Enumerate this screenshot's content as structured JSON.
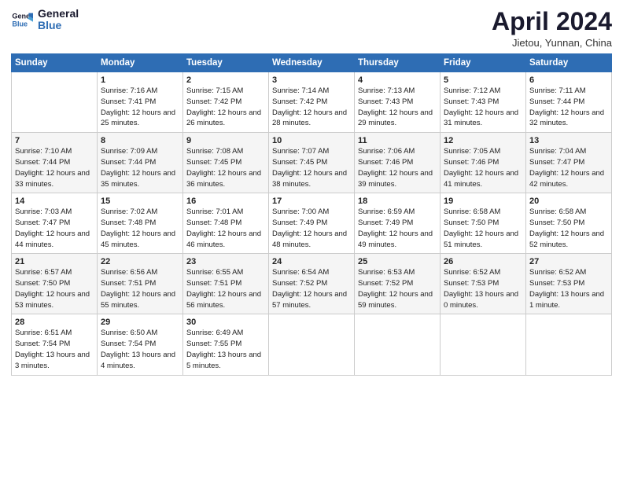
{
  "logo": {
    "line1": "General",
    "line2": "Blue"
  },
  "title": "April 2024",
  "subtitle": "Jietou, Yunnan, China",
  "headers": [
    "Sunday",
    "Monday",
    "Tuesday",
    "Wednesday",
    "Thursday",
    "Friday",
    "Saturday"
  ],
  "weeks": [
    [
      {
        "day": "",
        "sunrise": "",
        "sunset": "",
        "daylight": ""
      },
      {
        "day": "1",
        "sunrise": "Sunrise: 7:16 AM",
        "sunset": "Sunset: 7:41 PM",
        "daylight": "Daylight: 12 hours and 25 minutes."
      },
      {
        "day": "2",
        "sunrise": "Sunrise: 7:15 AM",
        "sunset": "Sunset: 7:42 PM",
        "daylight": "Daylight: 12 hours and 26 minutes."
      },
      {
        "day": "3",
        "sunrise": "Sunrise: 7:14 AM",
        "sunset": "Sunset: 7:42 PM",
        "daylight": "Daylight: 12 hours and 28 minutes."
      },
      {
        "day": "4",
        "sunrise": "Sunrise: 7:13 AM",
        "sunset": "Sunset: 7:43 PM",
        "daylight": "Daylight: 12 hours and 29 minutes."
      },
      {
        "day": "5",
        "sunrise": "Sunrise: 7:12 AM",
        "sunset": "Sunset: 7:43 PM",
        "daylight": "Daylight: 12 hours and 31 minutes."
      },
      {
        "day": "6",
        "sunrise": "Sunrise: 7:11 AM",
        "sunset": "Sunset: 7:44 PM",
        "daylight": "Daylight: 12 hours and 32 minutes."
      }
    ],
    [
      {
        "day": "7",
        "sunrise": "Sunrise: 7:10 AM",
        "sunset": "Sunset: 7:44 PM",
        "daylight": "Daylight: 12 hours and 33 minutes."
      },
      {
        "day": "8",
        "sunrise": "Sunrise: 7:09 AM",
        "sunset": "Sunset: 7:44 PM",
        "daylight": "Daylight: 12 hours and 35 minutes."
      },
      {
        "day": "9",
        "sunrise": "Sunrise: 7:08 AM",
        "sunset": "Sunset: 7:45 PM",
        "daylight": "Daylight: 12 hours and 36 minutes."
      },
      {
        "day": "10",
        "sunrise": "Sunrise: 7:07 AM",
        "sunset": "Sunset: 7:45 PM",
        "daylight": "Daylight: 12 hours and 38 minutes."
      },
      {
        "day": "11",
        "sunrise": "Sunrise: 7:06 AM",
        "sunset": "Sunset: 7:46 PM",
        "daylight": "Daylight: 12 hours and 39 minutes."
      },
      {
        "day": "12",
        "sunrise": "Sunrise: 7:05 AM",
        "sunset": "Sunset: 7:46 PM",
        "daylight": "Daylight: 12 hours and 41 minutes."
      },
      {
        "day": "13",
        "sunrise": "Sunrise: 7:04 AM",
        "sunset": "Sunset: 7:47 PM",
        "daylight": "Daylight: 12 hours and 42 minutes."
      }
    ],
    [
      {
        "day": "14",
        "sunrise": "Sunrise: 7:03 AM",
        "sunset": "Sunset: 7:47 PM",
        "daylight": "Daylight: 12 hours and 44 minutes."
      },
      {
        "day": "15",
        "sunrise": "Sunrise: 7:02 AM",
        "sunset": "Sunset: 7:48 PM",
        "daylight": "Daylight: 12 hours and 45 minutes."
      },
      {
        "day": "16",
        "sunrise": "Sunrise: 7:01 AM",
        "sunset": "Sunset: 7:48 PM",
        "daylight": "Daylight: 12 hours and 46 minutes."
      },
      {
        "day": "17",
        "sunrise": "Sunrise: 7:00 AM",
        "sunset": "Sunset: 7:49 PM",
        "daylight": "Daylight: 12 hours and 48 minutes."
      },
      {
        "day": "18",
        "sunrise": "Sunrise: 6:59 AM",
        "sunset": "Sunset: 7:49 PM",
        "daylight": "Daylight: 12 hours and 49 minutes."
      },
      {
        "day": "19",
        "sunrise": "Sunrise: 6:58 AM",
        "sunset": "Sunset: 7:50 PM",
        "daylight": "Daylight: 12 hours and 51 minutes."
      },
      {
        "day": "20",
        "sunrise": "Sunrise: 6:58 AM",
        "sunset": "Sunset: 7:50 PM",
        "daylight": "Daylight: 12 hours and 52 minutes."
      }
    ],
    [
      {
        "day": "21",
        "sunrise": "Sunrise: 6:57 AM",
        "sunset": "Sunset: 7:50 PM",
        "daylight": "Daylight: 12 hours and 53 minutes."
      },
      {
        "day": "22",
        "sunrise": "Sunrise: 6:56 AM",
        "sunset": "Sunset: 7:51 PM",
        "daylight": "Daylight: 12 hours and 55 minutes."
      },
      {
        "day": "23",
        "sunrise": "Sunrise: 6:55 AM",
        "sunset": "Sunset: 7:51 PM",
        "daylight": "Daylight: 12 hours and 56 minutes."
      },
      {
        "day": "24",
        "sunrise": "Sunrise: 6:54 AM",
        "sunset": "Sunset: 7:52 PM",
        "daylight": "Daylight: 12 hours and 57 minutes."
      },
      {
        "day": "25",
        "sunrise": "Sunrise: 6:53 AM",
        "sunset": "Sunset: 7:52 PM",
        "daylight": "Daylight: 12 hours and 59 minutes."
      },
      {
        "day": "26",
        "sunrise": "Sunrise: 6:52 AM",
        "sunset": "Sunset: 7:53 PM",
        "daylight": "Daylight: 13 hours and 0 minutes."
      },
      {
        "day": "27",
        "sunrise": "Sunrise: 6:52 AM",
        "sunset": "Sunset: 7:53 PM",
        "daylight": "Daylight: 13 hours and 1 minute."
      }
    ],
    [
      {
        "day": "28",
        "sunrise": "Sunrise: 6:51 AM",
        "sunset": "Sunset: 7:54 PM",
        "daylight": "Daylight: 13 hours and 3 minutes."
      },
      {
        "day": "29",
        "sunrise": "Sunrise: 6:50 AM",
        "sunset": "Sunset: 7:54 PM",
        "daylight": "Daylight: 13 hours and 4 minutes."
      },
      {
        "day": "30",
        "sunrise": "Sunrise: 6:49 AM",
        "sunset": "Sunset: 7:55 PM",
        "daylight": "Daylight: 13 hours and 5 minutes."
      },
      {
        "day": "",
        "sunrise": "",
        "sunset": "",
        "daylight": ""
      },
      {
        "day": "",
        "sunrise": "",
        "sunset": "",
        "daylight": ""
      },
      {
        "day": "",
        "sunrise": "",
        "sunset": "",
        "daylight": ""
      },
      {
        "day": "",
        "sunrise": "",
        "sunset": "",
        "daylight": ""
      }
    ]
  ]
}
